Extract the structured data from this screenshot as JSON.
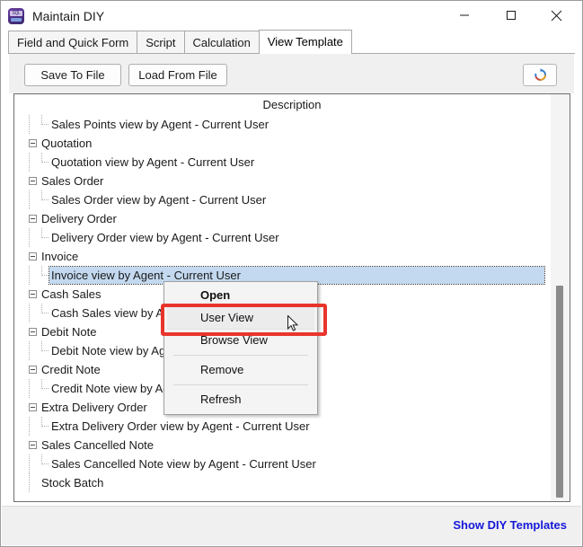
{
  "window": {
    "title": "Maintain DIY",
    "app_icon": "sql-app-icon",
    "controls": {
      "minimize": "minimize-icon",
      "maximize": "maximize-icon",
      "close": "close-icon"
    }
  },
  "tabs": [
    {
      "label": "Field and Quick Form",
      "active": false
    },
    {
      "label": "Script",
      "active": false
    },
    {
      "label": "Calculation",
      "active": false
    },
    {
      "label": "View Template",
      "active": true
    }
  ],
  "toolbar": {
    "save_to_file": "Save To File",
    "load_from_file": "Load From File",
    "refresh_icon": "refresh-icon"
  },
  "list": {
    "column_header": "Description",
    "rows": [
      {
        "type": "child",
        "label": "Sales Points view by Agent - Current User",
        "selected": false
      },
      {
        "type": "group",
        "label": "Quotation",
        "selected": false
      },
      {
        "type": "child",
        "label": "Quotation view by Agent - Current User",
        "selected": false
      },
      {
        "type": "group",
        "label": "Sales Order",
        "selected": false
      },
      {
        "type": "child",
        "label": "Sales Order view by Agent - Current User",
        "selected": false
      },
      {
        "type": "group",
        "label": "Delivery Order",
        "selected": false
      },
      {
        "type": "child",
        "label": "Delivery Order view by Agent - Current User",
        "selected": false
      },
      {
        "type": "group",
        "label": "Invoice",
        "selected": false
      },
      {
        "type": "child",
        "label": "Invoice view by Agent - Current User",
        "selected": true
      },
      {
        "type": "group",
        "label": "Cash Sales",
        "selected": false
      },
      {
        "type": "child",
        "label": "Cash Sales view by Agent - Current User",
        "selected": false
      },
      {
        "type": "group",
        "label": "Debit Note",
        "selected": false
      },
      {
        "type": "child",
        "label": "Debit Note view by Agent - Current User",
        "selected": false
      },
      {
        "type": "group",
        "label": "Credit Note",
        "selected": false
      },
      {
        "type": "child",
        "label": "Credit Note view by Agent - Current User",
        "selected": false
      },
      {
        "type": "group",
        "label": "Extra Delivery Order",
        "selected": false
      },
      {
        "type": "child",
        "label": "Extra Delivery Order view by Agent - Current User",
        "selected": false
      },
      {
        "type": "group",
        "label": "Sales Cancelled Note",
        "selected": false
      },
      {
        "type": "child",
        "label": "Sales Cancelled Note view by Agent - Current User",
        "selected": false
      },
      {
        "type": "leaf",
        "label": "Stock Batch",
        "selected": false
      }
    ]
  },
  "context_menu": {
    "items": [
      {
        "label": "Open",
        "bold": true,
        "hover": false,
        "separator_after": false
      },
      {
        "label": "User View",
        "bold": false,
        "hover": true,
        "separator_after": false
      },
      {
        "label": "Browse View",
        "bold": false,
        "hover": false,
        "separator_after": true
      },
      {
        "label": "Remove",
        "bold": false,
        "hover": false,
        "separator_after": true
      },
      {
        "label": "Refresh",
        "bold": false,
        "hover": false,
        "separator_after": false
      }
    ]
  },
  "annotation": {
    "highlight_color": "#e8352c",
    "target": "User View"
  },
  "statusbar": {
    "link_label": "Show DIY Templates",
    "link_color": "#1418d8"
  }
}
